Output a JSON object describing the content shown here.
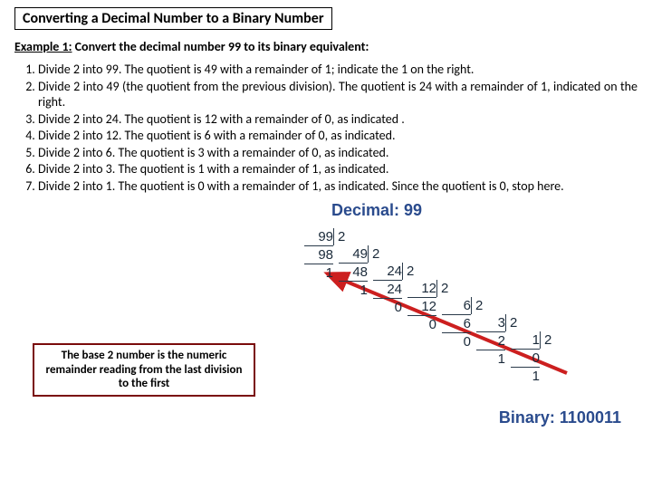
{
  "title": "Converting a Decimal Number to a Binary Number",
  "example": {
    "label": "Example 1:",
    "text": "Convert the decimal number 99 to its binary equivalent:"
  },
  "steps": [
    "Divide 2 into 99. The quotient is 49 with a remainder of 1; indicate the 1 on the right.",
    "Divide 2 into 49 (the quotient from the previous division). The quotient is 24 with a remainder of 1, indicated on the right.",
    "Divide 2 into 24. The quotient is 12 with a remainder of 0, as indicated .",
    "Divide 2 into 12. The quotient is 6 with a remainder of 0, as indicated.",
    "Divide 2 into 6. The quotient is 3 with a remainder of 0, as indicated.",
    "Divide 2 into 3. The quotient is 1 with a remainder of 1, as indicated.",
    "Divide 2 into 1. The quotient is 0 with a remainder of 1, as indicated. Since the quotient is 0, stop here."
  ],
  "callout": "The base 2 number is the numeric remainder reading from the last division to the first",
  "diagram": {
    "decimal_label": "Decimal: 99",
    "binary_label": "Binary: 1100011",
    "divisor": "2",
    "columns": [
      {
        "dividend": "99",
        "sub": "98",
        "rem": "1"
      },
      {
        "dividend": "49",
        "sub": "48",
        "rem": "1"
      },
      {
        "dividend": "24",
        "sub": "24",
        "rem": "0"
      },
      {
        "dividend": "12",
        "sub": "12",
        "rem": "0"
      },
      {
        "dividend": "6",
        "sub": "6",
        "rem": "0"
      },
      {
        "dividend": "3",
        "sub": "2",
        "rem": "1"
      },
      {
        "dividend": "1",
        "sub": "0",
        "rem": "1"
      }
    ]
  }
}
